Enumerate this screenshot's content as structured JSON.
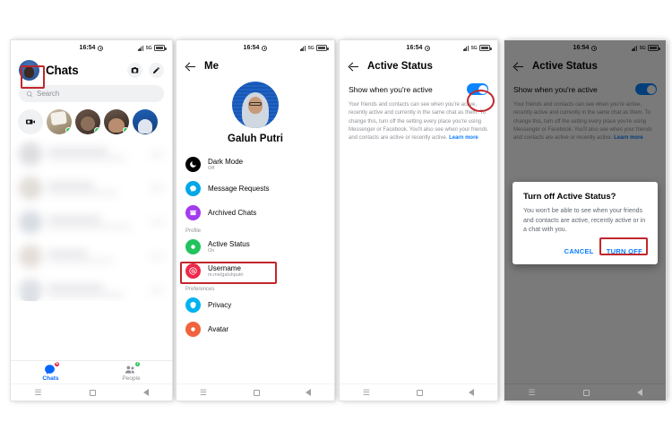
{
  "status_bar": {
    "time": "16:54",
    "alarm_icon": "alarm-icon",
    "signal_icon": "signal-icon",
    "network_label": "5G",
    "battery_icon": "battery-icon"
  },
  "android_nav": {
    "recents_icon": "recents-icon",
    "home_icon": "home-icon",
    "back_icon": "back-icon"
  },
  "panel1": {
    "name": "messenger-chats-screen",
    "avatar": "profile-avatar",
    "title": "Chats",
    "camera_icon": "camera-icon",
    "compose_icon": "compose-icon",
    "search": {
      "placeholder": "Search",
      "icon": "search-icon"
    },
    "stories": {
      "new_story_icon": "video-camera-plus-icon",
      "items": [
        "story-1",
        "story-2",
        "story-3",
        "story-4"
      ]
    },
    "bottom_nav": [
      {
        "label": "Chats",
        "icon": "chats-icon",
        "badge": "6",
        "active": true
      },
      {
        "label": "People",
        "icon": "people-icon",
        "badge": "7",
        "active": false
      }
    ]
  },
  "panel2": {
    "name": "me-settings-screen",
    "back_icon": "back-arrow-icon",
    "title": "Me",
    "profile_name": "Galuh Putri",
    "profile_avatar": "profile-avatar-large",
    "items": [
      {
        "icon": "dark-mode-icon",
        "label": "Dark Mode",
        "value": "Off",
        "color": "#000000"
      },
      {
        "icon": "message-requests-icon",
        "label": "Message Requests",
        "value": "",
        "color": "#00a8e8"
      },
      {
        "icon": "archived-chats-icon",
        "label": "Archived Chats",
        "value": "",
        "color": "#a33bf0"
      }
    ],
    "section_profile": "Profile",
    "profile_items": [
      {
        "icon": "active-status-icon",
        "label": "Active Status",
        "value": "On",
        "color": "#22c35e"
      },
      {
        "icon": "username-icon",
        "label": "Username",
        "value": "m.me/galuhputri",
        "color": "#f0274a"
      }
    ],
    "section_preferences": "Preferences",
    "preference_items": [
      {
        "icon": "privacy-icon",
        "label": "Privacy",
        "value": "",
        "color": "#00b2f0"
      },
      {
        "icon": "avatar-icon",
        "label": "Avatar",
        "value": "",
        "color": "#f0633c"
      }
    ]
  },
  "panel3": {
    "name": "active-status-screen",
    "back_icon": "back-arrow-icon",
    "title": "Active Status",
    "toggle_label": "Show when you're active",
    "toggle_state": "on",
    "description": "Your friends and contacts can see when you're active, recently active and currently in the same chat as them. To change this, turn off the setting every place you're using Messenger or Facebook. You'll also see when your friends and contacts are active or recently active.",
    "learn_more": "Learn more"
  },
  "panel4": {
    "name": "active-status-confirm-screen",
    "back_icon": "back-arrow-icon",
    "title": "Active Status",
    "toggle_label": "Show when you're active",
    "toggle_state": "on",
    "description": "Your friends and contacts can see when you're active, recently active and currently in the same chat as them. To change this, turn off the setting every place you're using Messenger or Facebook. You'll also see when your friends and contacts are active or recently active.",
    "learn_more": "Learn more",
    "dialog": {
      "title": "Turn off Active Status?",
      "body": "You won't be able to see when your friends and contacts are active, recently active or in a chat with you.",
      "cancel_label": "CANCEL",
      "confirm_label": "TURN OFF"
    }
  },
  "annotations": {
    "color": "#c1272d",
    "targets": [
      "panel1-avatar",
      "panel2-active-status-row",
      "panel3-toggle",
      "panel4-turn-off-button"
    ]
  }
}
